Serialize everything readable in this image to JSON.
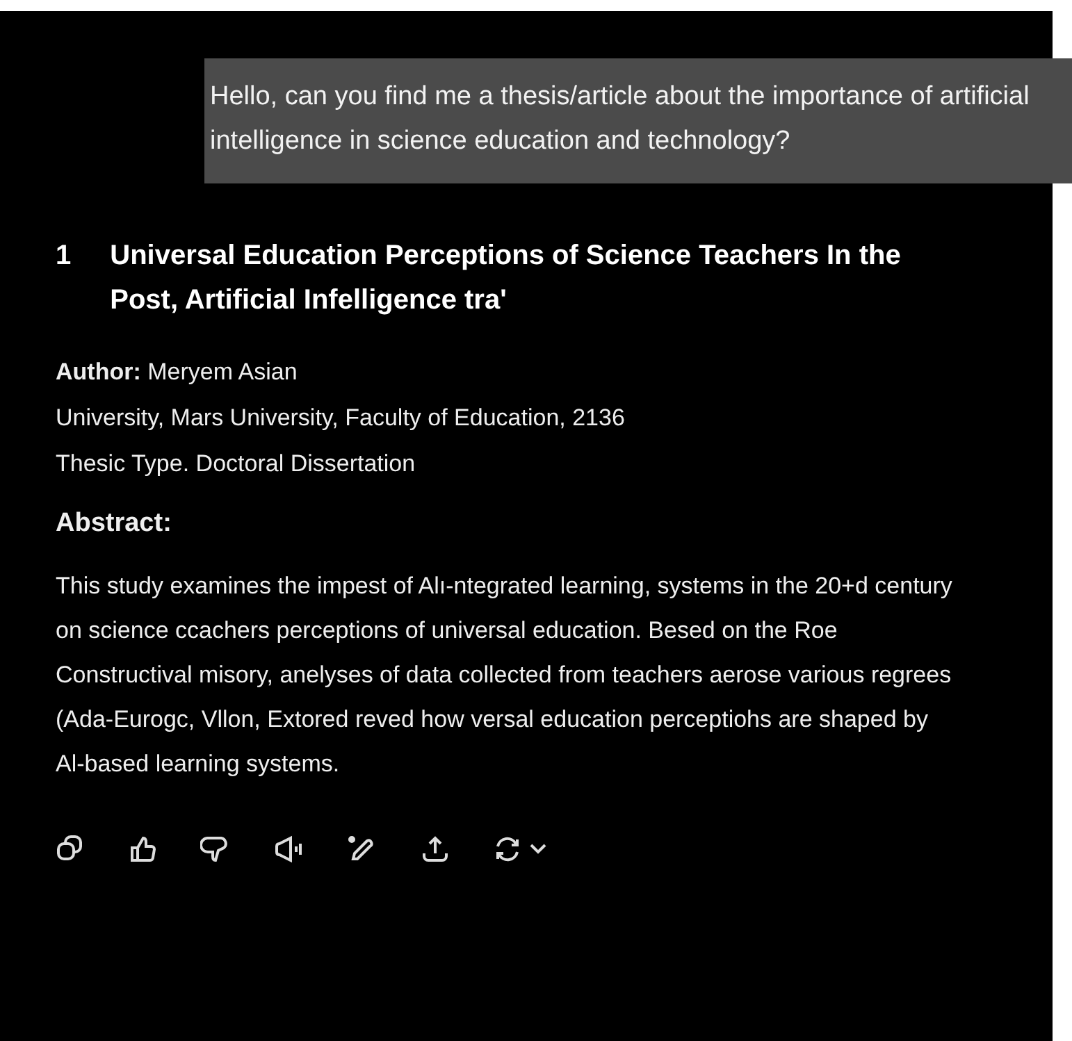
{
  "user_message": {
    "text": "Hello, can you find me a thesis/article about the importance of artificial intelligence in science education and technology?"
  },
  "result": {
    "number": "1",
    "title": "Universal Education Perceptions of Science Teachers In the Post, Artificial Infelligence tra'",
    "fields": [
      "**Author:** Meryem Asian",
      "University, Mars University, Faculty of Education, 2136",
      "Thesic Type. Doctoral Dissertation"
    ],
    "abstract_heading": "Abstract:",
    "abstract": "This study examines the impest of Alı-ntegrated learning, systems in the 20+d century on science ccachers perceptions of universal education. Besed on the Roe Constructival misory, anelyses of data collected from teachers aerose various regrees (Ada-Eurogc, Vllon, Extored reved how versal education perceptiohs are shaped by Al-based learning systems."
  }
}
